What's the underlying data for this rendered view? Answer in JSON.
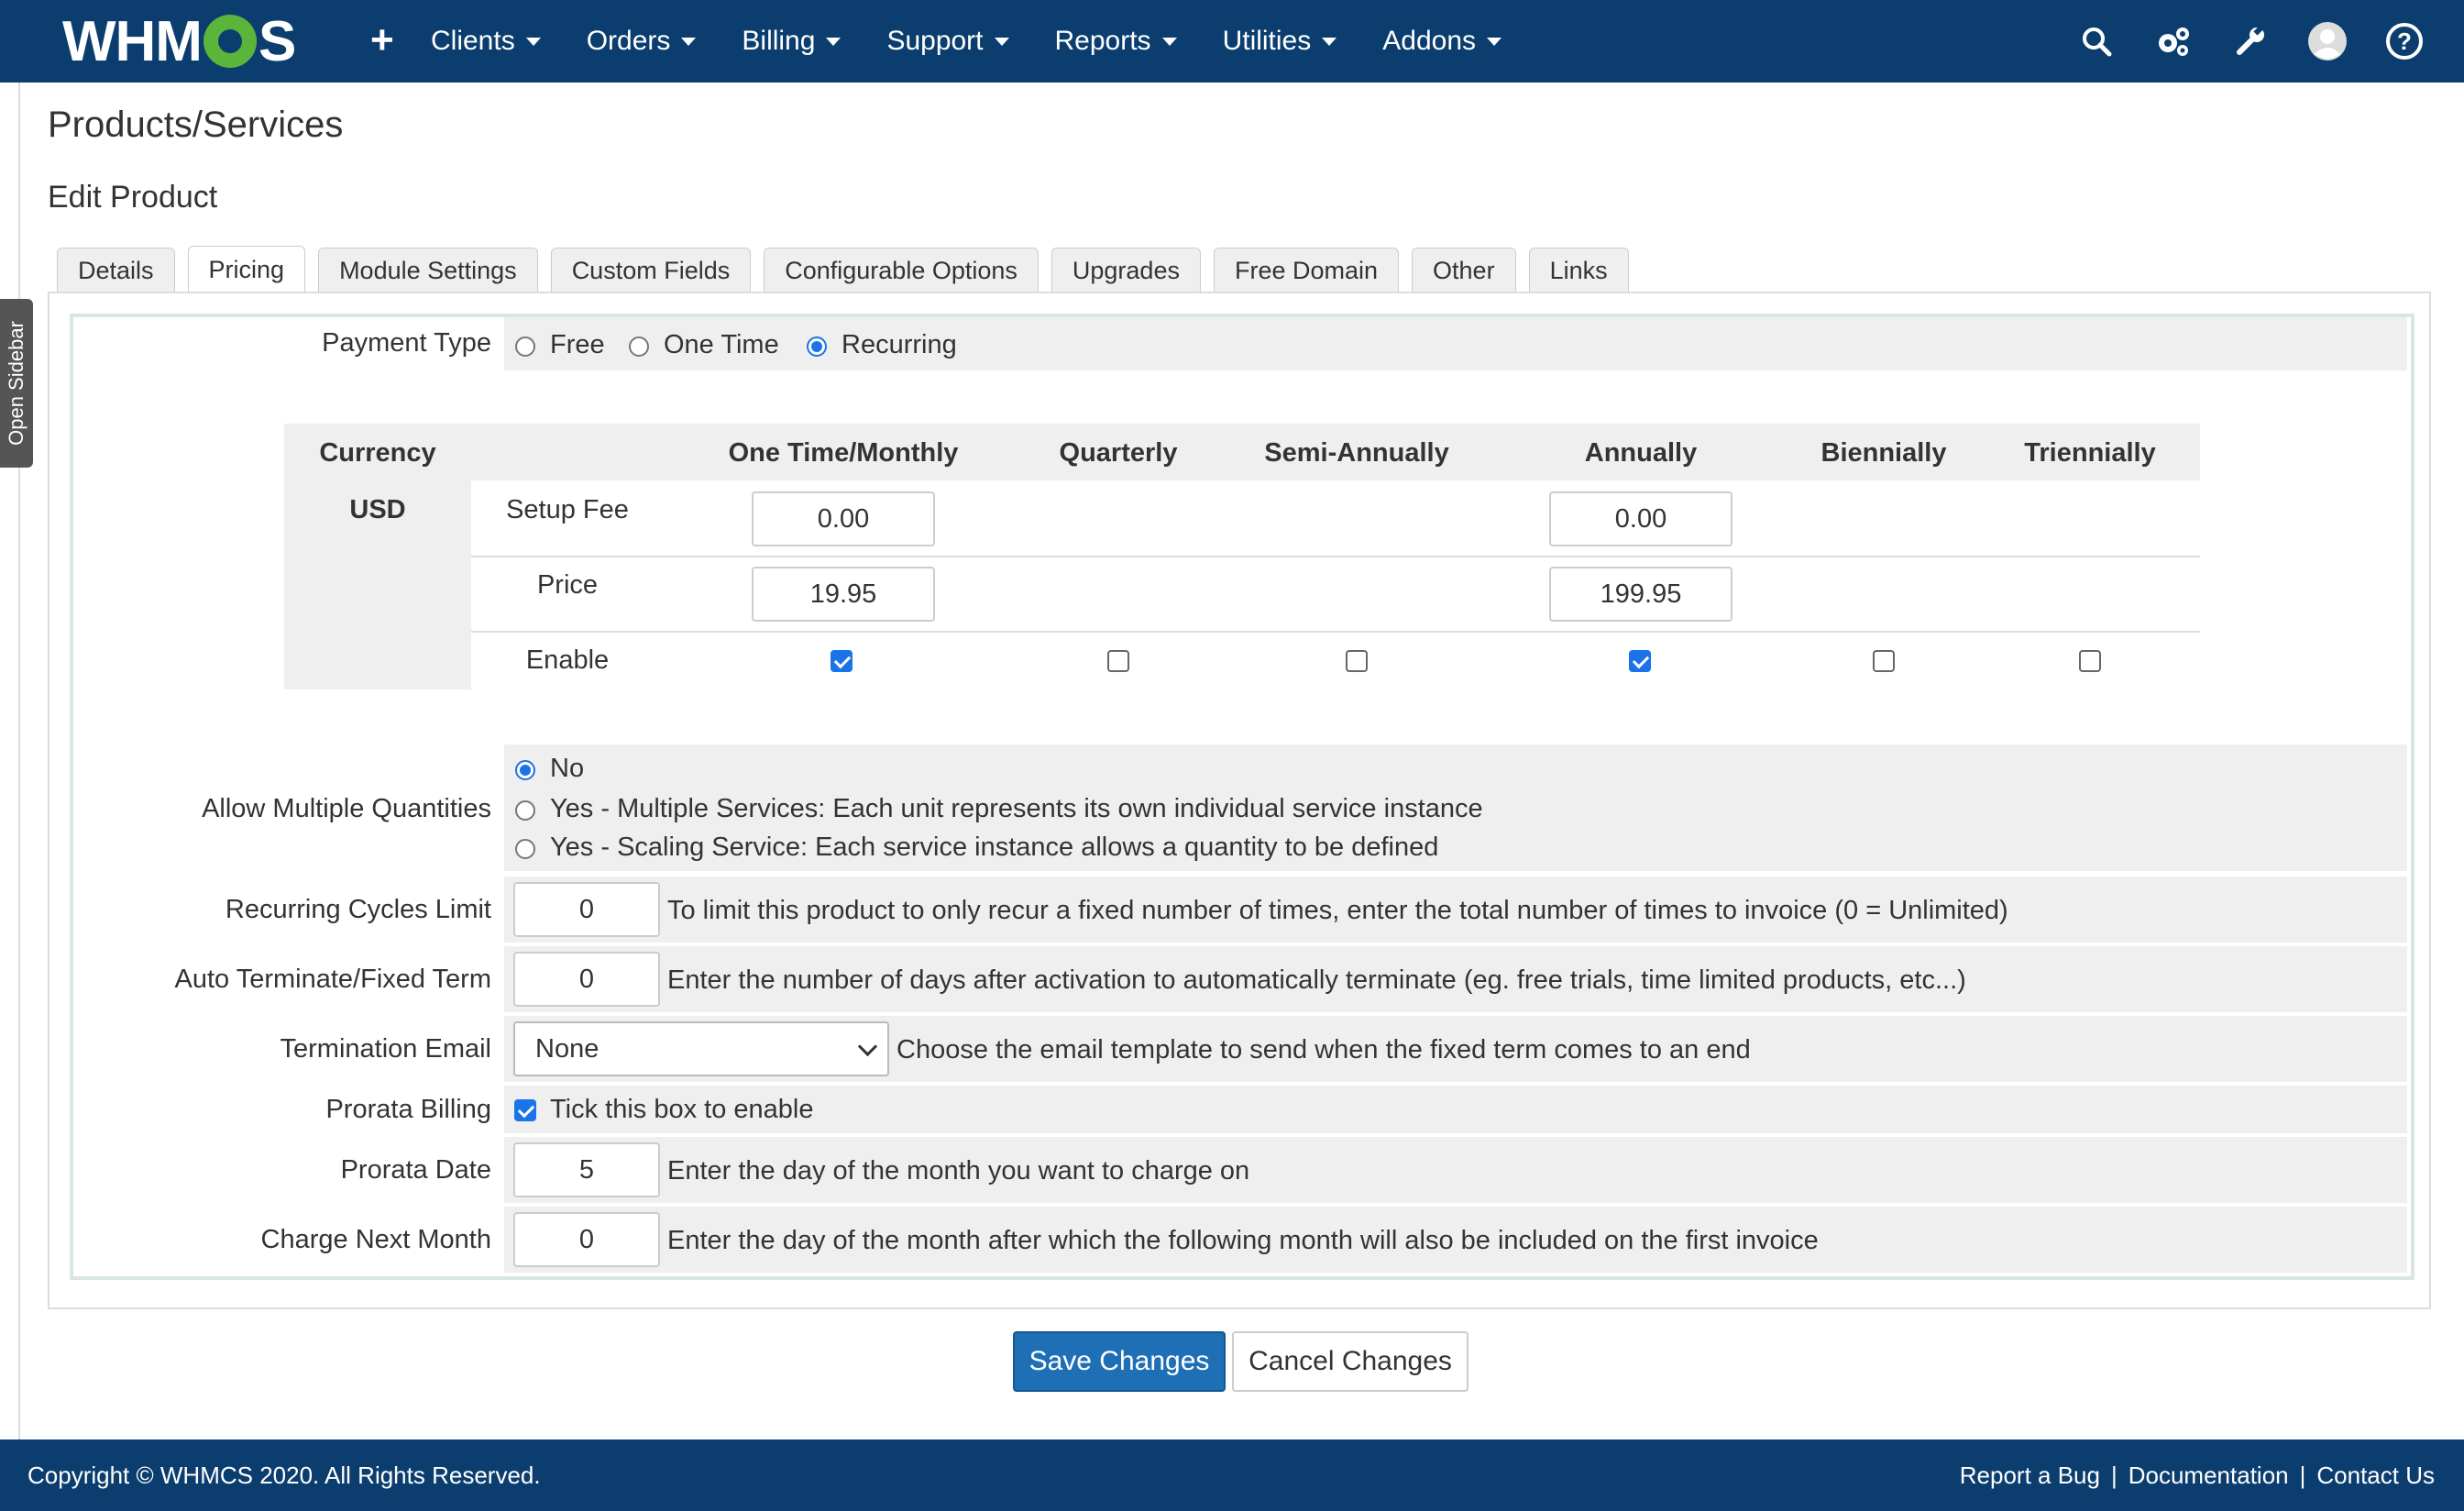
{
  "navbar": {
    "logo_text_left": "WHM",
    "logo_text_right": "S",
    "add_icon": "+",
    "menu": [
      {
        "label": "Clients"
      },
      {
        "label": "Orders"
      },
      {
        "label": "Billing"
      },
      {
        "label": "Support"
      },
      {
        "label": "Reports"
      },
      {
        "label": "Utilities"
      },
      {
        "label": "Addons"
      }
    ],
    "icons": [
      "search-icon",
      "gears-icon",
      "wrench-icon",
      "user-avatar-icon",
      "help-icon"
    ]
  },
  "sidebar_toggle": "Open Sidebar",
  "page_title": "Products/Services",
  "sub_title": "Edit Product",
  "tabs": [
    {
      "label": "Details"
    },
    {
      "label": "Pricing",
      "active": true
    },
    {
      "label": "Module Settings"
    },
    {
      "label": "Custom Fields"
    },
    {
      "label": "Configurable Options"
    },
    {
      "label": "Upgrades"
    },
    {
      "label": "Free Domain"
    },
    {
      "label": "Other"
    },
    {
      "label": "Links"
    }
  ],
  "payment_type": {
    "label": "Payment Type",
    "options": [
      "Free",
      "One Time",
      "Recurring"
    ],
    "selected": "Recurring"
  },
  "pricing_table": {
    "headers": [
      "Currency",
      "One Time/Monthly",
      "Quarterly",
      "Semi-Annually",
      "Annually",
      "Biennially",
      "Triennially"
    ],
    "currency": "USD",
    "rows": {
      "setup_fee": {
        "label": "Setup Fee",
        "monthly": "0.00",
        "annually": "0.00"
      },
      "price": {
        "label": "Price",
        "monthly": "19.95",
        "annually": "199.95"
      },
      "enable": {
        "label": "Enable",
        "checked": [
          true,
          false,
          false,
          true,
          false,
          false
        ]
      }
    }
  },
  "allow_multiple_quantities": {
    "label": "Allow Multiple Quantities",
    "options": [
      "No",
      "Yes - Multiple Services: Each unit represents its own individual service instance",
      "Yes - Scaling Service: Each service instance allows a quantity to be defined"
    ],
    "selected": "No"
  },
  "recurring_cycles_limit": {
    "label": "Recurring Cycles Limit",
    "value": "0",
    "help": "To limit this product to only recur a fixed number of times, enter the total number of times to invoice (0 = Unlimited)"
  },
  "auto_terminate": {
    "label": "Auto Terminate/Fixed Term",
    "value": "0",
    "help": "Enter the number of days after activation to automatically terminate (eg. free trials, time limited products, etc...)"
  },
  "termination_email": {
    "label": "Termination Email",
    "value": "None",
    "help": "Choose the email template to send when the fixed term comes to an end"
  },
  "prorata_billing": {
    "label": "Prorata Billing",
    "checked": true,
    "help": "Tick this box to enable"
  },
  "prorata_date": {
    "label": "Prorata Date",
    "value": "5",
    "help": "Enter the day of the month you want to charge on"
  },
  "charge_next_month": {
    "label": "Charge Next Month",
    "value": "0",
    "help": "Enter the day of the month after which the following month will also be included on the first invoice"
  },
  "buttons": {
    "save": "Save Changes",
    "cancel": "Cancel Changes"
  },
  "footer": {
    "copyright": "Copyright © WHMCS 2020. All Rights Reserved.",
    "links": [
      "Report a Bug",
      "Documentation",
      "Contact Us"
    ],
    "separator": "|"
  },
  "colors": {
    "navbar_bg": "#0b3e6f",
    "accent": "#1e6fb5",
    "logo_gear": "#5bb53b",
    "checkbox": "#1a73e8"
  }
}
